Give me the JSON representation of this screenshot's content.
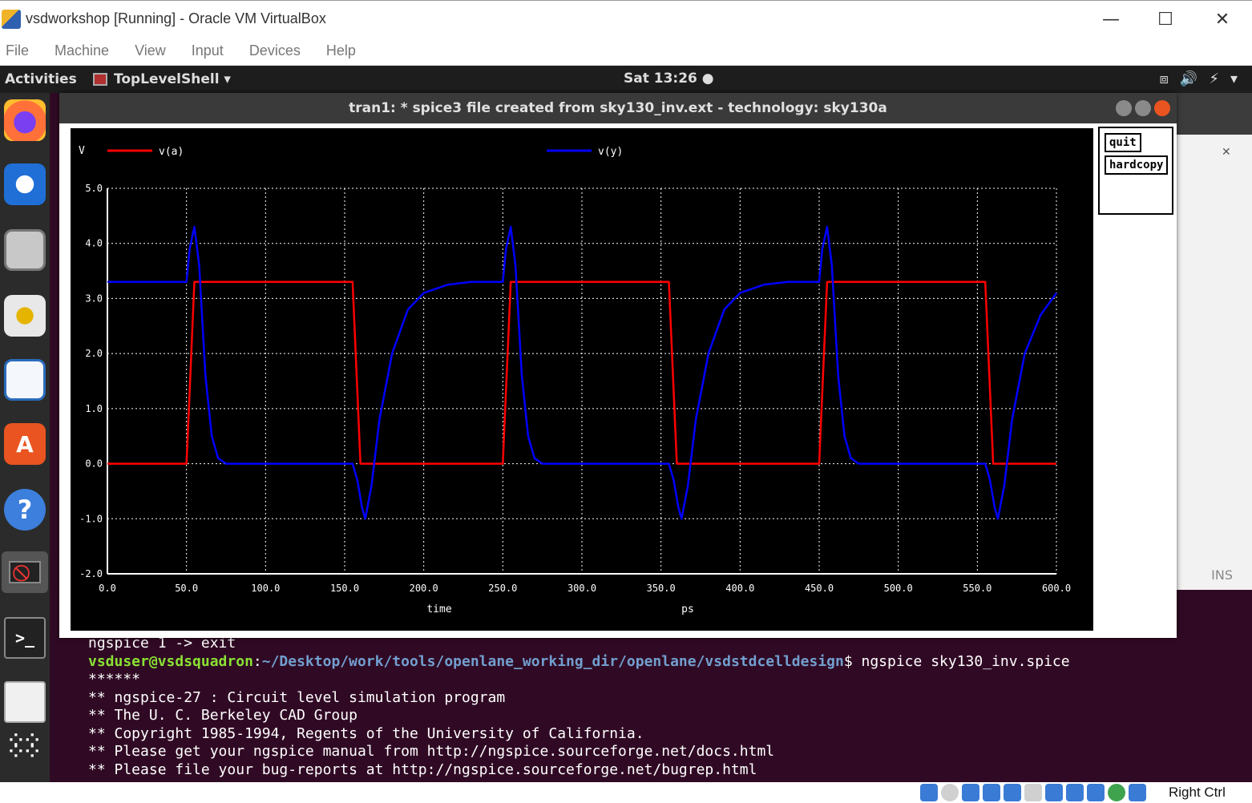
{
  "vbox": {
    "title": "vsdworkshop [Running] - Oracle VM VirtualBox",
    "menus": [
      "File",
      "Machine",
      "View",
      "Input",
      "Devices",
      "Help"
    ],
    "min_glyph": "—",
    "max_glyph": "☐",
    "close_glyph": "✕",
    "host_key": "Right Ctrl"
  },
  "gnome": {
    "activities": "Activities",
    "app_name": "TopLevelShell ▾",
    "clock": "Sat 13:26 ●"
  },
  "plot_window": {
    "title": "tran1: * spice3 file created from sky130_inv.ext - technology: sky130a",
    "quit_label": "quit",
    "hardcopy_label": "hardcopy"
  },
  "chart_data": {
    "type": "line",
    "y_unit_label": "V",
    "x_unit_label": "ps",
    "xlabel": "time",
    "xlim": [
      0,
      600
    ],
    "ylim": [
      -2,
      5
    ],
    "x_ticks": [
      "0.0",
      "50.0",
      "100.0",
      "150.0",
      "200.0",
      "250.0",
      "300.0",
      "350.0",
      "400.0",
      "450.0",
      "500.0",
      "550.0",
      "600.0"
    ],
    "y_ticks": [
      "5.0",
      "4.0",
      "3.0",
      "2.0",
      "1.0",
      "0.0",
      "-1.0",
      "-2.0"
    ],
    "grid": true,
    "series": [
      {
        "name": "v(a)",
        "color": "#ff0000",
        "x": [
          0,
          50,
          55,
          155,
          160,
          250,
          255,
          355,
          360,
          450,
          455,
          555,
          560,
          600
        ],
        "y": [
          0,
          0,
          3.3,
          3.3,
          0,
          0,
          3.3,
          3.3,
          0,
          0,
          3.3,
          3.3,
          0,
          0
        ]
      },
      {
        "name": "v(y)",
        "color": "#0000ff",
        "x": [
          0,
          50,
          52,
          55,
          58,
          62,
          66,
          70,
          75,
          155,
          158,
          161,
          163,
          167,
          172,
          180,
          190,
          200,
          215,
          230,
          250,
          252,
          255,
          258,
          262,
          266,
          270,
          275,
          355,
          358,
          361,
          363,
          367,
          372,
          380,
          390,
          400,
          415,
          430,
          450,
          452,
          455,
          458,
          462,
          466,
          470,
          475,
          555,
          558,
          561,
          563,
          567,
          572,
          580,
          590,
          600
        ],
        "y": [
          3.3,
          3.3,
          3.9,
          4.3,
          3.6,
          1.6,
          0.5,
          0.1,
          0,
          0,
          -0.3,
          -0.8,
          -1.0,
          -0.4,
          0.8,
          2.0,
          2.8,
          3.1,
          3.25,
          3.3,
          3.3,
          3.9,
          4.3,
          3.6,
          1.6,
          0.5,
          0.1,
          0,
          0,
          -0.3,
          -0.8,
          -1.0,
          -0.4,
          0.8,
          2.0,
          2.8,
          3.1,
          3.25,
          3.3,
          3.3,
          3.9,
          4.3,
          3.6,
          1.6,
          0.5,
          0.1,
          0,
          0,
          -0.3,
          -0.8,
          -1.0,
          -0.4,
          0.8,
          2.0,
          2.7,
          3.1
        ]
      }
    ]
  },
  "terminal": {
    "line1": "ngspice 1 -> exit",
    "prompt_user": "vsduser@vsdsquadron",
    "prompt_sep": ":",
    "prompt_path": "~/Desktop/work/tools/openlane_working_dir/openlane/vsdstdcelldesign",
    "prompt_cmd": "$ ngspice sky130_inv.spice",
    "line3": "******",
    "line4": "** ngspice-27 : Circuit level simulation program",
    "line5": "** The U. C. Berkeley CAD Group",
    "line6": "** Copyright 1985-1994, Regents of the University of California.",
    "line7": "** Please get your ngspice manual from http://ngspice.sourceforge.net/docs.html",
    "line8": "** Please file your bug-reports at http://ngspice.sourceforge.net/bugrep.html"
  },
  "side_window": {
    "close_glyph": "✕",
    "status": "INS"
  },
  "dock_items": [
    "firefox-icon",
    "thunderbird-icon",
    "files-icon",
    "rhythmbox-icon",
    "writer-icon",
    "software-icon",
    "help-icon",
    "blocked-app-icon",
    "terminal-icon",
    "text-editor-icon",
    "app-grid-icon"
  ]
}
